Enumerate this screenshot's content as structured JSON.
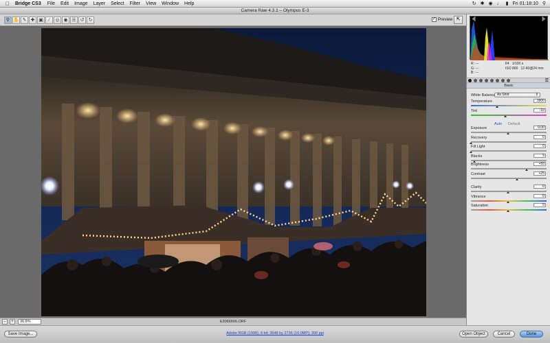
{
  "menubar": {
    "app_name": "Bridge CS3",
    "items": [
      "File",
      "Edit",
      "Image",
      "Layer",
      "Select",
      "Filter",
      "View",
      "Window",
      "Help"
    ],
    "clock": "Fri 01:18:10"
  },
  "window": {
    "title": "Camera Raw 4.3.1  –  Olympus E-3"
  },
  "toolbar": {
    "tools": [
      "zoom-icon",
      "hand-icon",
      "white-balance-icon",
      "color-sampler-icon",
      "crop-icon",
      "straighten-icon",
      "retouch-icon",
      "red-eye-icon",
      "preferences-icon",
      "rotate-left-icon",
      "rotate-right-icon"
    ],
    "preview_label": "Preview",
    "preview_checked": true
  },
  "status": {
    "zoom_minus": "–",
    "zoom_plus": "+",
    "zoom_value": "36.8%",
    "filename": "E3066666.ORF"
  },
  "bottom": {
    "save_label": "Save Image...",
    "workflow_text": "Adobe RGB (1998); 8 bit; 3648 by 2736 (10.0MP); 300 ppi",
    "open_label": "Open Object",
    "cancel_label": "Cancel",
    "done_label": "Done"
  },
  "camera_info": {
    "r_label": "R:",
    "r_val": "---",
    "g_label": "G:",
    "g_val": "---",
    "b_label": "B:",
    "b_val": "---",
    "aperture": "f/4",
    "shutter": "1/100 s",
    "iso": "ISO 800",
    "lens": "12-60@24 mm"
  },
  "basic": {
    "header": "Basic",
    "white_balance_label": "White Balance:",
    "white_balance_value": "As Shot",
    "auto_label": "Auto",
    "default_label": "Default",
    "sliders": [
      {
        "id": "temperature",
        "label": "Temperature",
        "value": "3900",
        "pos": 0.35
      },
      {
        "id": "tint",
        "label": "Tint",
        "value": "-10",
        "pos": 0.46
      },
      {
        "id": "exposure",
        "label": "Exposure",
        "value": "0.00",
        "pos": 0.5
      },
      {
        "id": "recovery",
        "label": "Recovery",
        "value": "0",
        "pos": 0.0
      },
      {
        "id": "fill-light",
        "label": "Fill Light",
        "value": "0",
        "pos": 0.0
      },
      {
        "id": "blacks",
        "label": "Blacks",
        "value": "5",
        "pos": 0.05
      },
      {
        "id": "brightness",
        "label": "Brightness",
        "value": "+50",
        "pos": 0.75
      },
      {
        "id": "contrast",
        "label": "Contrast",
        "value": "+25",
        "pos": 0.62
      },
      {
        "id": "clarity",
        "label": "Clarity",
        "value": "0",
        "pos": 0.5
      },
      {
        "id": "vibrance",
        "label": "Vibrance",
        "value": "0",
        "pos": 0.5
      },
      {
        "id": "saturation",
        "label": "Saturation",
        "value": "0",
        "pos": 0.5
      }
    ]
  },
  "colors": {
    "accent": "#5b95d8",
    "panel_bg": "#e6e6e6",
    "link": "#1a3ed0"
  }
}
